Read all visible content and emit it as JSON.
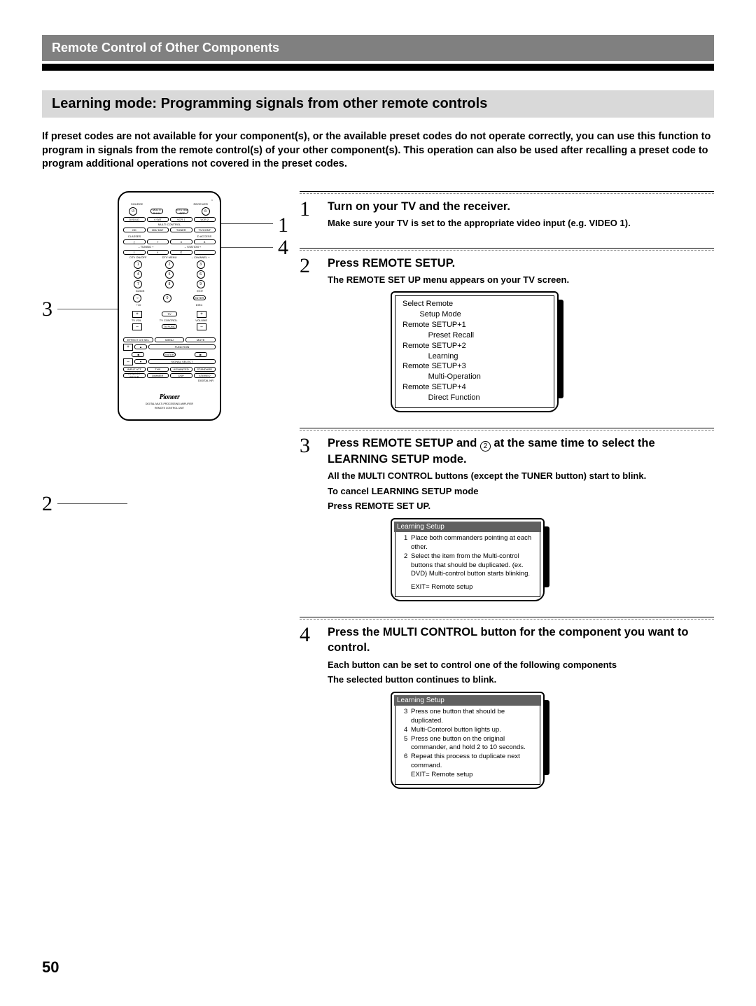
{
  "header": "Remote Control of Other Components",
  "section_title": "Learning mode: Programming signals from other remote controls",
  "intro": "If preset codes are not available for your component(s), or the available preset codes do not operate correctly, you can use this function to program in signals from the remote control(s) of your other component(s). This operation can also be used after recalling a preset code to program additional operations not covered in the preset codes.",
  "callouts": {
    "c1": "1",
    "c2": "2",
    "c3": "3",
    "c4": "4"
  },
  "remote": {
    "source": "SOURCE",
    "receiver": "RECEIVER",
    "multi_ch": "MULTI\nCH IN",
    "system_off": "SYSTEM\nOFF",
    "dvdld": "DVD/LD",
    "vsat": "V.SAT",
    "vcr1": "VCR 1",
    "vcr2": "VCR 2",
    "cd": "CD",
    "mddat": "MD/\nDAT",
    "tuner": "TUNER",
    "tvcont": "TV/CONT",
    "multi_control": "MULTI CONTROL",
    "classes": "CLASSES",
    "tuning_minus": "– TUNING +",
    "station_minus": "– STATION +",
    "d_access": "D.ACCESS",
    "f": "ƒ",
    "e": "ℇ",
    "dtv_onoff": "DTV ON/OFF",
    "dtvmenu": "DTV MENU",
    "channel": "– CHANNEL +",
    "guide": "GUIDE",
    "exit": "EXIT",
    "enter": "ENTER",
    "plus10": "+10",
    "disc": "DISC",
    "tv": "TV",
    "tvvol": "TV VOL",
    "tvcontrol": "TV CONTROL",
    "volume": "VOLUME",
    "tvfunc": "TV FUNC",
    "effect": "EFFECT\nCH SEL",
    "menu": "MENU",
    "mute": "MUTE",
    "func": "FUNCTION",
    "enter2": "ENTER",
    "signal": "SIGNAL\nSELECT",
    "dnr": "DIGITAL\nNR",
    "input_att": "INPUT\nATT",
    "thx": "THX",
    "adv": "ADVANCED",
    "std": "STANDARD",
    "midnight": "MIDNIGHT",
    "remote_setup": "REMOTE\nSETUP",
    "dimmer": "DIMMER",
    "dsp": "DSP",
    "stereo": "STEREO",
    "digital_nr": "DIGITAL NR",
    "brand": "Pioneer",
    "sub1": "DIGITAL MULTI-PROCESSING AMPLIFIER",
    "sub2": "REMOTE CONTROL UNIT"
  },
  "steps": [
    {
      "num": "1",
      "title": "Turn on your TV and the receiver.",
      "detail": "Make sure your TV is set to the appropriate video input (e.g. VIDEO 1)."
    },
    {
      "num": "2",
      "title": "Press REMOTE SETUP.",
      "detail": "The REMOTE SET UP menu appears on your TV screen.",
      "tv": {
        "lines": [
          "Select Remote",
          "        Setup Mode",
          "Remote SETUP+1",
          "            Preset Recall",
          "Remote SETUP+2",
          "            Learning",
          "Remote SETUP+3",
          "            Multi-Operation",
          "Remote SETUP+4",
          "            Direct Function"
        ]
      }
    },
    {
      "num": "3",
      "title_pre": "Press REMOTE SETUP and ",
      "title_icon": "2",
      "title_post": " at the same time to select the LEARNING SETUP mode.",
      "details": [
        "All the MULTI CONTROL  buttons (except the TUNER button) start to blink.",
        "To cancel LEARNING SETUP mode",
        "Press REMOTE SET UP."
      ],
      "tv": {
        "header": "Learning Setup",
        "items": [
          {
            "ix": "1",
            "tx": "Place both commanders pointing at each other."
          },
          {
            "ix": "2",
            "tx": "Select the item from the Multi-control buttons that should be duplicated. (ex. DVD) Multi-control button starts blinking."
          }
        ],
        "footer": "EXIT= Remote setup"
      }
    },
    {
      "num": "4",
      "title": "Press the MULTI CONTROL button for the component you want to control.",
      "details": [
        "Each button can be set to control one of the following components",
        "The selected button continues to blink."
      ],
      "tv": {
        "header": "Learning Setup",
        "items": [
          {
            "ix": "3",
            "tx": "Press one button that should be duplicated."
          },
          {
            "ix": "4",
            "tx": "Multi-Contorol  button lights up."
          },
          {
            "ix": "5",
            "tx": "Press one button on the original commander, and hold 2 to 10 seconds."
          },
          {
            "ix": "6",
            "tx": "Repeat this process to duplicate next command."
          }
        ],
        "footer": "EXIT= Remote setup",
        "footer_in_list": true
      }
    }
  ],
  "page_number": "50"
}
